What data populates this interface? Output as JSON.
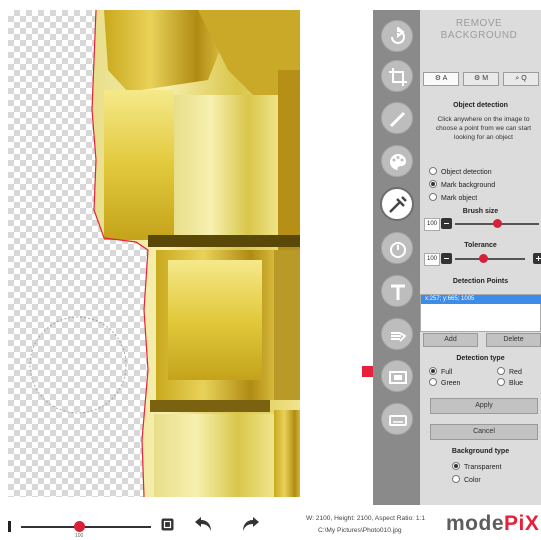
{
  "colors": {
    "accent": "#e8203a",
    "panel_bg": "#dcdcdc",
    "toolbar_bg": "#8a8a8a",
    "selection": "#3d8de8"
  },
  "toolbar": {
    "tools": [
      {
        "name": "rotate-icon",
        "active": false
      },
      {
        "name": "crop-icon",
        "active": false
      },
      {
        "name": "brush-icon",
        "active": false
      },
      {
        "name": "palette-icon",
        "active": false
      },
      {
        "name": "remove-background-icon",
        "active": true
      },
      {
        "name": "timer-icon",
        "active": false
      },
      {
        "name": "text-icon",
        "active": false
      },
      {
        "name": "hand-icon",
        "active": false
      },
      {
        "name": "frame-icon",
        "active": false
      },
      {
        "name": "keyboard-icon",
        "active": false
      }
    ]
  },
  "panel": {
    "title": "REMOVE BACKGROUND",
    "tabs": [
      {
        "label": "A",
        "icon": "gear-icon"
      },
      {
        "label": "M",
        "icon": "gear-icon"
      },
      {
        "label": "Q",
        "icon": "search-icon"
      }
    ],
    "object_detection": {
      "title": "Object detection",
      "description": "Click anywhere on the image to choose a point from we can start looking for an object",
      "options": [
        {
          "label": "Object detection",
          "checked": false
        },
        {
          "label": "Mark background",
          "checked": true
        },
        {
          "label": "Mark object",
          "checked": false
        }
      ]
    },
    "brush_size": {
      "label": "Brush size",
      "value": "100",
      "level": 0.5
    },
    "tolerance": {
      "label": "Tolerance",
      "value": "100",
      "level": 0.4
    },
    "detection_points": {
      "label": "Detection Points",
      "items": [
        "x:257; y:665; 1005"
      ],
      "add_label": "Add",
      "delete_label": "Delete"
    },
    "detection_type": {
      "label": "Detection type",
      "options": [
        {
          "label": "Full",
          "checked": true
        },
        {
          "label": "Red",
          "checked": false
        },
        {
          "label": "Green",
          "checked": false
        },
        {
          "label": "Blue",
          "checked": false
        }
      ]
    },
    "apply_label": "Apply",
    "cancel_label": "Cancel",
    "background_type": {
      "label": "Background type",
      "options": [
        {
          "label": "Transparent",
          "checked": true
        },
        {
          "label": "Color",
          "checked": false
        }
      ]
    }
  },
  "bottom": {
    "zoom_value": "100",
    "info": "W: 2100, Height: 2100, Aspect Ratio: 1:1",
    "path": "C:\\My Pictures\\Photo010.jpg",
    "logo_main": "mode",
    "logo_accent": "PiX"
  }
}
